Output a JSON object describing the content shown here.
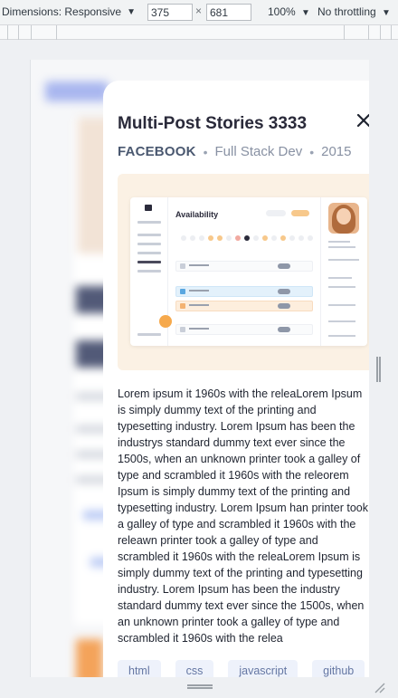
{
  "devtools": {
    "dimensions_label": "Dimensions: Responsive",
    "width_value": "375",
    "height_value": "681",
    "times": "×",
    "zoom": "100%",
    "throttling": "No throttling",
    "caret": "▼"
  },
  "modal": {
    "title": "Multi-Post Stories 3333",
    "company": "FACEBOOK",
    "role": "Full Stack Dev",
    "year": "2015",
    "separator": "•",
    "close_icon": "close-icon",
    "screenshot": {
      "heading": "Availability"
    },
    "description": "Lorem ipsum it 1960s with the releaLorem Ipsum is simply dummy text of the printing and typesetting industry. Lorem Ipsum has been the industrys standard dummy text ever since the 1500s, when an unknown printer took a galley of type and scrambled it 1960s with the releorem Ipsum is simply dummy text of the printing and typesetting industry. Lorem Ipsum han printer took a galley of type and scrambled it 1960s with the releawn printer took a galley of type and scrambled it 1960s with the releaLorem Ipsum is simply dummy text of the printing and typesetting industry. Lorem Ipsum has been the industry standard dummy text ever since the 1500s, when an unknown printer took a galley of type and scrambled it 1960s with the relea",
    "tags": [
      "html",
      "css",
      "javascript",
      "github"
    ]
  },
  "colors": {
    "title": "#2a2a3a",
    "company": "#4a5870",
    "tag_bg": "#eef2fb",
    "tag_text": "#6577a3"
  }
}
